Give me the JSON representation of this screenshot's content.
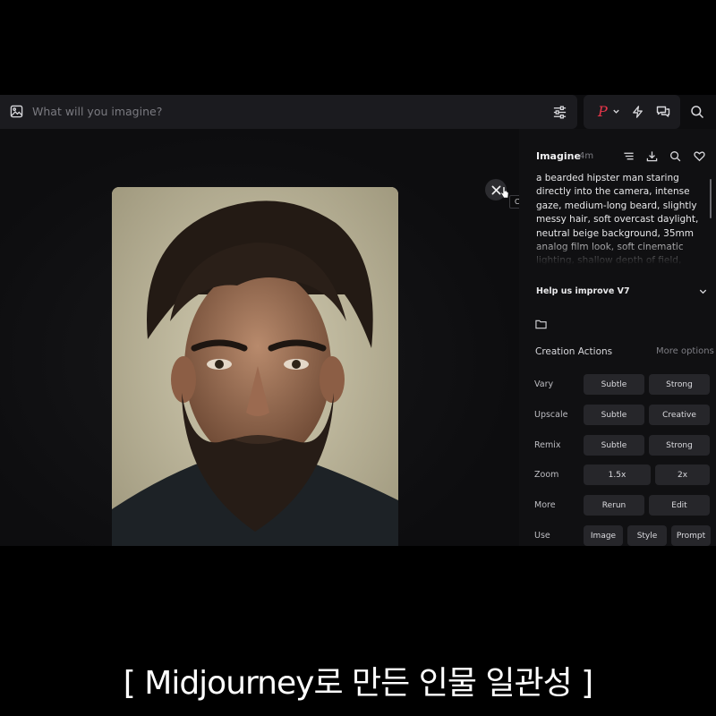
{
  "prompt_bar": {
    "placeholder": "What will you imagine?"
  },
  "profile": {
    "logo": "P"
  },
  "viewer": {
    "tooltip": "Close"
  },
  "panel": {
    "title": "Imagine",
    "time": "4m",
    "prompt": "a bearded hipster man staring directly into the camera, intense gaze, medium-long beard, slightly messy hair, soft overcast daylight, neutral beige background, 35mm analog film look, soft cinematic lighting, shallow depth of field, Kodak",
    "help": "Help us improve V7",
    "creation_actions": "Creation Actions",
    "more_options": "More options",
    "rows": [
      {
        "label": "Vary",
        "buttons": [
          "Subtle",
          "Strong"
        ]
      },
      {
        "label": "Upscale",
        "buttons": [
          "Subtle",
          "Creative"
        ]
      },
      {
        "label": "Remix",
        "buttons": [
          "Subtle",
          "Strong"
        ]
      },
      {
        "label": "Zoom",
        "buttons": [
          "1.5x",
          "2x"
        ]
      },
      {
        "label": "More",
        "buttons": [
          "Rerun",
          "Edit"
        ]
      },
      {
        "label": "Use",
        "buttons": [
          "Image",
          "Style",
          "Prompt"
        ]
      }
    ]
  },
  "caption": "[ Midjourney로 만든 인물 일관성 ]",
  "colors": {
    "accent": "#e8364a",
    "panel": "#101012",
    "button": "#26262a"
  }
}
